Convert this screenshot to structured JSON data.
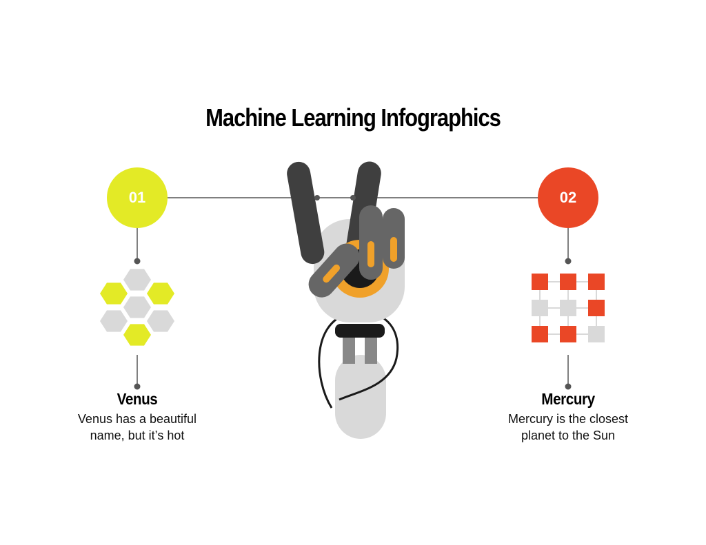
{
  "title": "Machine Learning Infographics",
  "colors": {
    "yellow": "#e3ea26",
    "red": "#ea4726",
    "dark_gray": "#3f3f3f",
    "mid_gray": "#666666",
    "light_gray": "#d9d9d9",
    "orange": "#f0a12a",
    "line": "#555555"
  },
  "items": [
    {
      "number": "01",
      "title": "Venus",
      "description_line1": "Venus has a beautiful",
      "description_line2": "name, but it’s hot",
      "icon": "hexagon-cluster-icon"
    },
    {
      "number": "02",
      "title": "Mercury",
      "description_line1": "Mercury is the closest",
      "description_line2": "planet to the Sun",
      "icon": "node-grid-icon"
    }
  ],
  "center_illustration": "robot-hand-peace-sign-icon"
}
